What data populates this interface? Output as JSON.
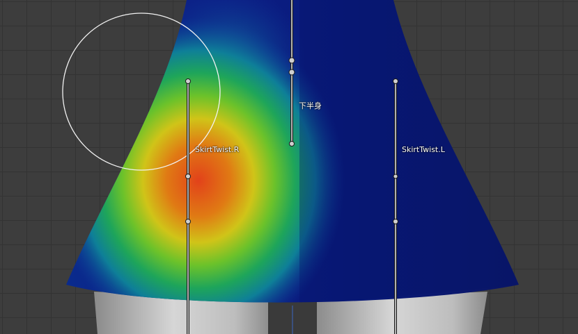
{
  "bones": [
    {
      "id": "lower-body",
      "label": "下半身"
    },
    {
      "id": "skirt-twist-r",
      "label": "SkirtTwist.R"
    },
    {
      "id": "skirt-twist-l",
      "label": "SkirtTwist.L"
    }
  ],
  "colors": {
    "background": "#3d3d3d",
    "grid": "#333333",
    "weight_cold": "#0a1a86",
    "weight_mid": "#1ca84a",
    "weight_hot": "#e0401a",
    "bone": "#9a9a9a",
    "brush_cursor": "#f0f0f0"
  }
}
